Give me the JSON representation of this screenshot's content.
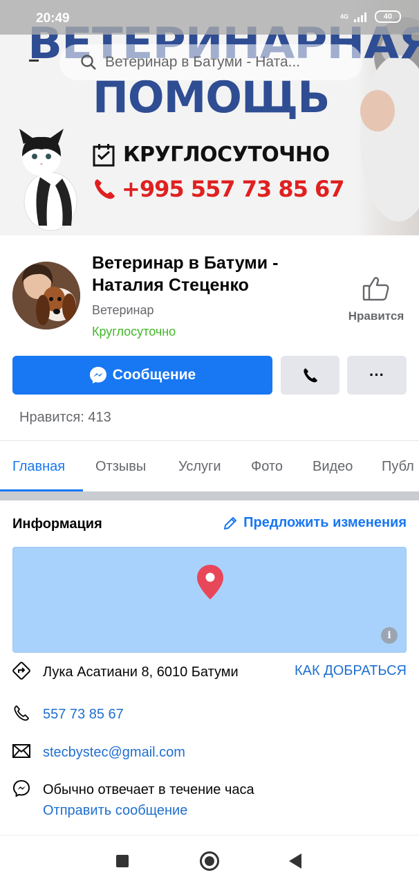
{
  "status_bar": {
    "time": "20:49",
    "network": "4G",
    "battery": "40"
  },
  "search": {
    "placeholder": "Ветеринар в Батуми - Ната..."
  },
  "cover": {
    "headline_1": "ВЕТЕРИНАРНАЯ",
    "headline_2": "ПОМОЩЬ",
    "hours_badge": "24h",
    "hours_text": "КРУГЛОСУТОЧНО",
    "phone_text": "+995 557 73 85 67"
  },
  "profile": {
    "name": "Ветеринар в Батуми - Наталия Стеценко",
    "category": "Ветеринар",
    "hours": "Круглосуточно",
    "like_label": "Нравится"
  },
  "actions": {
    "message_label": "Сообщение",
    "more_label": "···"
  },
  "likes_text": "Нравится: 413",
  "tabs": [
    {
      "label": "Главная"
    },
    {
      "label": "Отзывы"
    },
    {
      "label": "Услуги"
    },
    {
      "label": "Фото"
    },
    {
      "label": "Видео"
    },
    {
      "label": "Публ"
    }
  ],
  "info": {
    "title": "Информация",
    "suggest_label": "Предложить изменения",
    "address": "Лука Асатиани 8, 6010 Батуми",
    "directions_label": "КАК ДОБРАТЬСЯ",
    "phone": "557 73 85 67",
    "email": "stecbystec@gmail.com",
    "response_time": "Обычно отвечает в течение часа",
    "send_message_label": "Отправить сообщение"
  },
  "colors": {
    "accent": "#1877f2",
    "link": "#1f6fcf",
    "open_green": "#42b72a",
    "cover_blue": "#2f4d93",
    "cover_red": "#e02020",
    "map_blue": "#a8d2fb",
    "pin_red": "#e8475a"
  }
}
